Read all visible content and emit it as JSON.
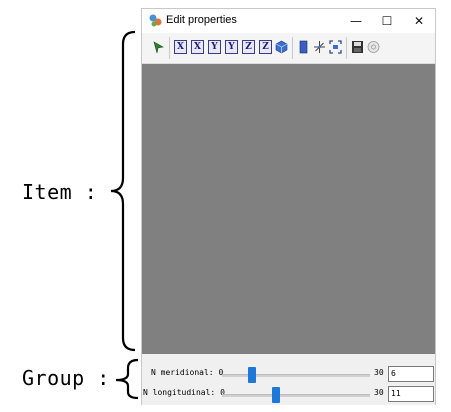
{
  "annotations": {
    "item_label": "Item :",
    "group_label": "Group :"
  },
  "window": {
    "title": "Edit properties",
    "minimize_glyph": "—",
    "maximize_glyph": "☐",
    "close_glyph": "✕"
  },
  "toolbar": {
    "axis_buttons": [
      "X",
      "X",
      "Y",
      "Y",
      "Z",
      "Z"
    ],
    "icons": [
      "select-arrow-icon",
      "view-x-icon",
      "view-minus-x-icon",
      "view-y-icon",
      "view-minus-y-icon",
      "view-z-icon",
      "view-minus-z-icon",
      "isometric-cube-icon",
      "layers-icon",
      "axes-icon",
      "fit-view-icon",
      "save-icon",
      "settings-disc-icon"
    ]
  },
  "group": {
    "meridional": {
      "label": "N meridional:",
      "min": "0",
      "max": "30",
      "value": "6",
      "fraction": 0.2
    },
    "longitudinal": {
      "label": "N longitudinal:",
      "min": "0",
      "max": "30",
      "value": "11",
      "fraction": 0.367
    }
  },
  "colors": {
    "viewport": "#808080",
    "slider_thumb": "#1e78d7",
    "axis_button": "#3a3a8c"
  }
}
